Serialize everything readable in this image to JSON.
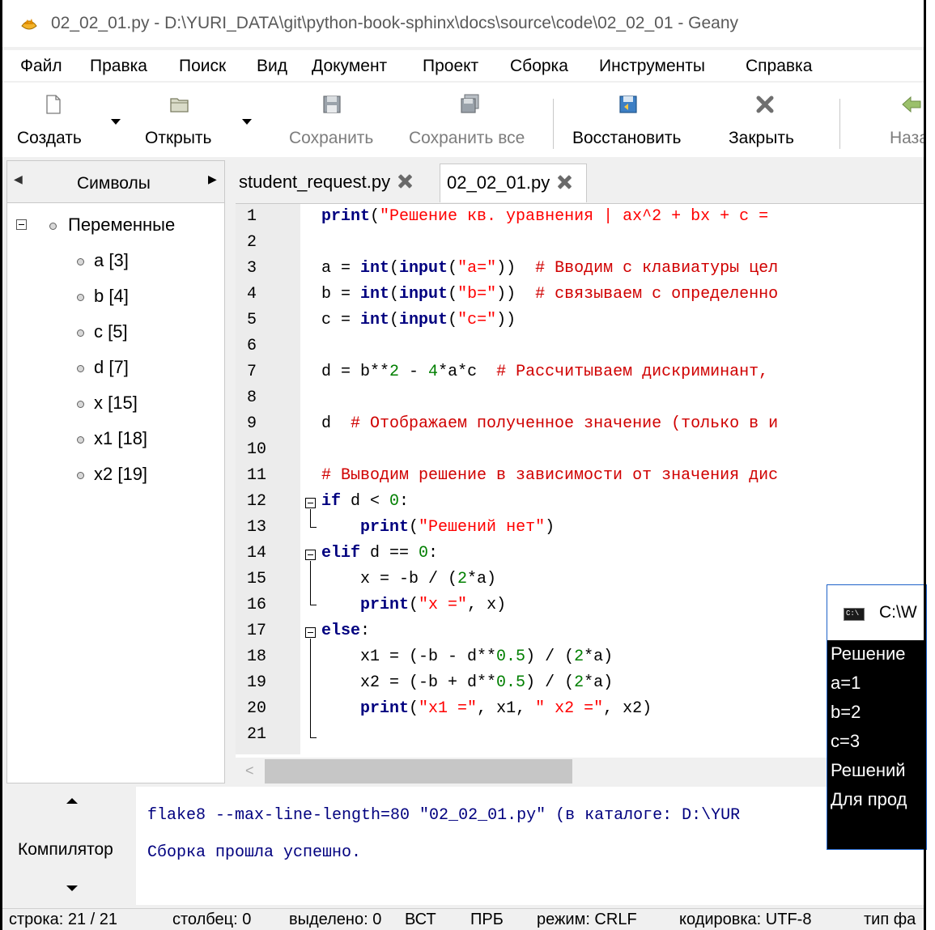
{
  "window": {
    "title": "02_02_01.py - D:\\YURI_DATA\\git\\python-book-sphinx\\docs\\source\\code\\02_02_01 - Geany"
  },
  "menu": [
    "Файл",
    "Правка",
    "Поиск",
    "Вид",
    "Документ",
    "Проект",
    "Сборка",
    "Инструменты",
    "Справка"
  ],
  "toolbar": {
    "new": "Создать",
    "open": "Открыть",
    "save": "Сохранить",
    "save_all": "Сохранить все",
    "revert": "Восстановить",
    "close": "Закрыть",
    "back": "Наза"
  },
  "sidebar": {
    "tab": "Символы",
    "group": "Переменные",
    "items": [
      "a [3]",
      "b [4]",
      "c [5]",
      "d [7]",
      "x [15]",
      "x1 [18]",
      "x2 [19]"
    ]
  },
  "tabs": [
    "student_request.py",
    "02_02_01.py"
  ],
  "line_numbers": [
    "1",
    "2",
    "3",
    "4",
    "5",
    "6",
    "7",
    "8",
    "9",
    "10",
    "11",
    "12",
    "13",
    "14",
    "15",
    "16",
    "17",
    "18",
    "19",
    "20",
    "21"
  ],
  "code": {
    "l1": [
      {
        "t": "print",
        "c": "kw"
      },
      {
        "t": "(",
        "c": ""
      },
      {
        "t": "\"Решение кв. уравнения | ax^2 + bx + c = ",
        "c": "str"
      }
    ],
    "l3": [
      {
        "t": "a = ",
        "c": ""
      },
      {
        "t": "int",
        "c": "kw"
      },
      {
        "t": "(",
        "c": ""
      },
      {
        "t": "input",
        "c": "kw"
      },
      {
        "t": "(",
        "c": ""
      },
      {
        "t": "\"a=\"",
        "c": "str"
      },
      {
        "t": "))  ",
        "c": ""
      },
      {
        "t": "# Вводим с клавиатуры цел",
        "c": "cmt"
      }
    ],
    "l4": [
      {
        "t": "b = ",
        "c": ""
      },
      {
        "t": "int",
        "c": "kw"
      },
      {
        "t": "(",
        "c": ""
      },
      {
        "t": "input",
        "c": "kw"
      },
      {
        "t": "(",
        "c": ""
      },
      {
        "t": "\"b=\"",
        "c": "str"
      },
      {
        "t": "))  ",
        "c": ""
      },
      {
        "t": "# связываем с определенно",
        "c": "cmt"
      }
    ],
    "l5": [
      {
        "t": "c = ",
        "c": ""
      },
      {
        "t": "int",
        "c": "kw"
      },
      {
        "t": "(",
        "c": ""
      },
      {
        "t": "input",
        "c": "kw"
      },
      {
        "t": "(",
        "c": ""
      },
      {
        "t": "\"c=\"",
        "c": "str"
      },
      {
        "t": "))",
        "c": ""
      }
    ],
    "l7": [
      {
        "t": "d = b**",
        "c": ""
      },
      {
        "t": "2",
        "c": "num"
      },
      {
        "t": " - ",
        "c": ""
      },
      {
        "t": "4",
        "c": "num"
      },
      {
        "t": "*a*c  ",
        "c": ""
      },
      {
        "t": "# Рассчитываем дискриминант,",
        "c": "cmt"
      }
    ],
    "l9": [
      {
        "t": "d  ",
        "c": ""
      },
      {
        "t": "# Отображаем полученное значение (только в и",
        "c": "cmt"
      }
    ],
    "l11": [
      {
        "t": "# Выводим решение в зависимости от значения дис",
        "c": "cmt"
      }
    ],
    "l12": [
      {
        "t": "if",
        "c": "kw"
      },
      {
        "t": " d < ",
        "c": ""
      },
      {
        "t": "0",
        "c": "num"
      },
      {
        "t": ":",
        "c": ""
      }
    ],
    "l13": [
      {
        "t": "    ",
        "c": ""
      },
      {
        "t": "print",
        "c": "kw"
      },
      {
        "t": "(",
        "c": ""
      },
      {
        "t": "\"Решений нет\"",
        "c": "str"
      },
      {
        "t": ")",
        "c": ""
      }
    ],
    "l14": [
      {
        "t": "elif",
        "c": "kw"
      },
      {
        "t": " d == ",
        "c": ""
      },
      {
        "t": "0",
        "c": "num"
      },
      {
        "t": ":",
        "c": ""
      }
    ],
    "l15": [
      {
        "t": "    x = -b / (",
        "c": ""
      },
      {
        "t": "2",
        "c": "num"
      },
      {
        "t": "*a)",
        "c": ""
      }
    ],
    "l16": [
      {
        "t": "    ",
        "c": ""
      },
      {
        "t": "print",
        "c": "kw"
      },
      {
        "t": "(",
        "c": ""
      },
      {
        "t": "\"x =\"",
        "c": "str"
      },
      {
        "t": ", x)",
        "c": ""
      }
    ],
    "l17": [
      {
        "t": "else",
        "c": "kw"
      },
      {
        "t": ":",
        "c": ""
      }
    ],
    "l18": [
      {
        "t": "    x1 = (-b - d**",
        "c": ""
      },
      {
        "t": "0.5",
        "c": "num"
      },
      {
        "t": ") / (",
        "c": ""
      },
      {
        "t": "2",
        "c": "num"
      },
      {
        "t": "*a)",
        "c": ""
      }
    ],
    "l19": [
      {
        "t": "    x2 = (-b + d**",
        "c": ""
      },
      {
        "t": "0.5",
        "c": "num"
      },
      {
        "t": ") / (",
        "c": ""
      },
      {
        "t": "2",
        "c": "num"
      },
      {
        "t": "*a)",
        "c": ""
      }
    ],
    "l20": [
      {
        "t": "    ",
        "c": ""
      },
      {
        "t": "print",
        "c": "kw"
      },
      {
        "t": "(",
        "c": ""
      },
      {
        "t": "\"x1 =\"",
        "c": "str"
      },
      {
        "t": ", x1, ",
        "c": ""
      },
      {
        "t": "\" x2 =\"",
        "c": "str"
      },
      {
        "t": ", x2)",
        "c": ""
      }
    ]
  },
  "messages": {
    "tab": "Компилятор",
    "lines": [
      "flake8 --max-line-length=80 \"02_02_01.py\" (в каталоге: D:\\YUR",
      "Сборка прошла успешно."
    ]
  },
  "console": {
    "title": "C:\\W",
    "lines": [
      "Решение",
      "a=1",
      "b=2",
      "c=3",
      "Решений",
      "Для прод"
    ]
  },
  "status": {
    "line": "строка: 21 / 21",
    "col": "столбец: 0",
    "sel": "выделено: 0",
    "ins": "ВСТ",
    "tab": "ПРБ",
    "mode": "режим: CRLF",
    "enc": "кодировка: UTF-8",
    "type": "тип фа"
  },
  "colors": {
    "keyword": "#00007f",
    "string": "#ff0000",
    "number": "#007f00",
    "comment": "#d00000",
    "message": "#00007f"
  }
}
